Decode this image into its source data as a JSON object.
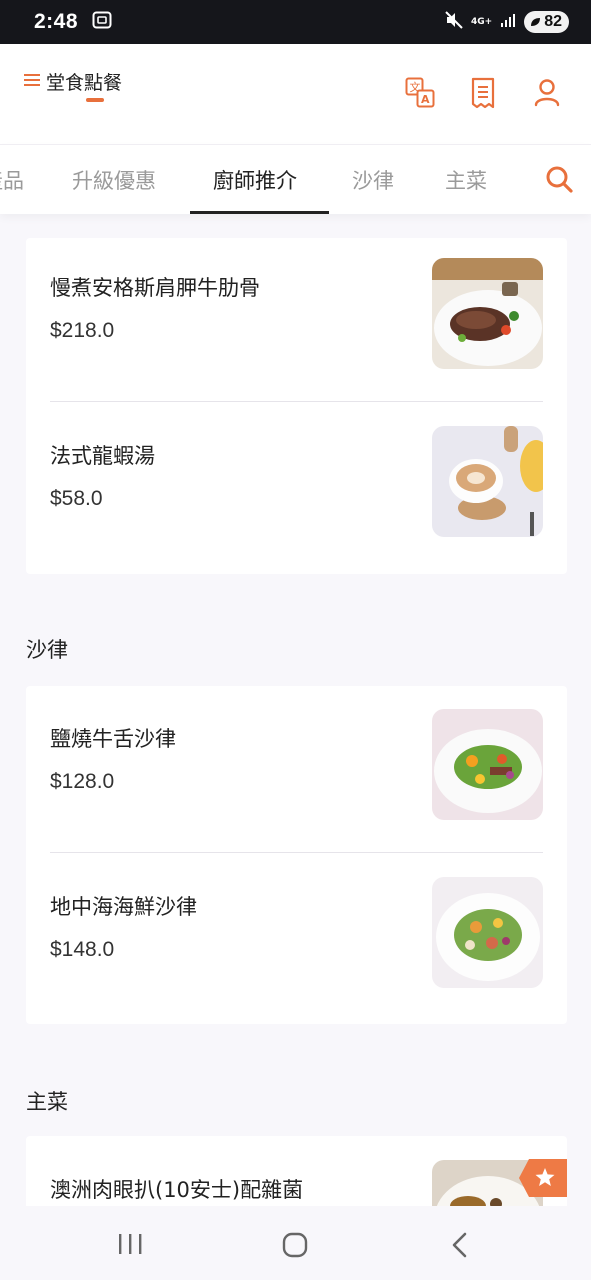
{
  "status_bar": {
    "time": "2:48",
    "network": "4G+",
    "battery": "82"
  },
  "header": {
    "title": "堂食點餐"
  },
  "tabs": [
    {
      "label": "產品"
    },
    {
      "label": "升級優惠"
    },
    {
      "label": "廚師推介",
      "active": true
    },
    {
      "label": "沙律"
    },
    {
      "label": "主菜"
    }
  ],
  "sections": [
    {
      "title": "",
      "items": [
        {
          "name": "慢煮安格斯肩胛牛肋骨",
          "price": "$218.0"
        },
        {
          "name": "法式龍蝦湯",
          "price": "$58.0"
        }
      ]
    },
    {
      "title": "沙律",
      "items": [
        {
          "name": "鹽燒牛舌沙律",
          "price": "$128.0"
        },
        {
          "name": "地中海海鮮沙律",
          "price": "$148.0"
        }
      ]
    },
    {
      "title": "主菜",
      "items": [
        {
          "name": "澳洲肉眼扒(10安士)配雜菌",
          "price": ""
        }
      ]
    }
  ],
  "colors": {
    "accent": "#e8703c",
    "status_bar": "#15161b",
    "background": "#f8f7fb"
  }
}
